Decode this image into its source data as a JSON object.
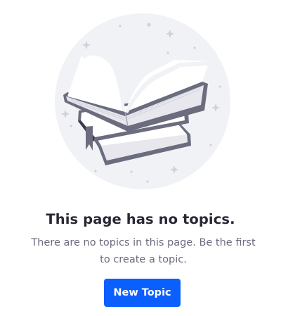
{
  "empty_state": {
    "illustration_icon": "open-book-stack-icon",
    "title": "This page has no topics.",
    "description": "There are no topics in this page. Be the first to create a topic.",
    "button_label": "New Topic"
  },
  "colors": {
    "accent": "#0b5fff",
    "title_text": "#272833",
    "body_text": "#6b6c7e",
    "illustration_background": "#f1f2f5"
  }
}
